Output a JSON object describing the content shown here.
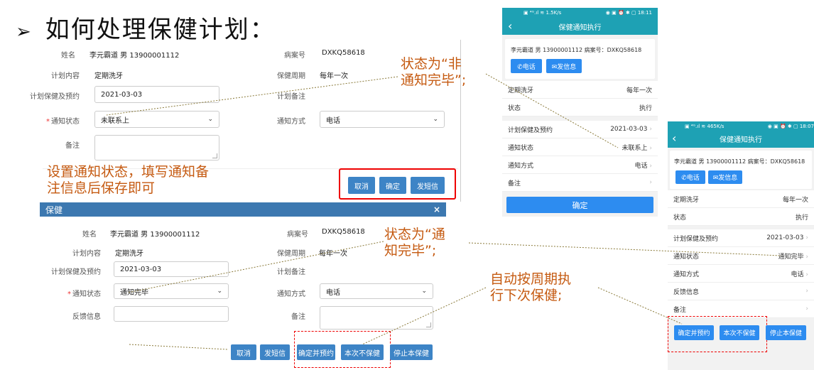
{
  "slide": {
    "arrow": "➢",
    "title": "如何处理保健计划："
  },
  "form_top": {
    "name_label": "姓名",
    "name_value": "李元霸道 男 13900001112",
    "record_label": "病案号",
    "record_value": "DXKQ58618",
    "plan_label": "计划内容",
    "plan_value": "定期洗牙",
    "cycle_label": "保健周期",
    "cycle_value": "每年一次",
    "appoint_label": "计划保健及预约",
    "appoint_value": "2021-03-03",
    "plan_note_label": "计划备注",
    "status_label": "通知状态",
    "status_value": "未联系上",
    "method_label": "通知方式",
    "method_value": "电话",
    "remark_label": "备注",
    "buttons": {
      "cancel": "取消",
      "confirm": "确定",
      "sms": "发短信"
    }
  },
  "annotations": {
    "a1": [
      "状态为“非",
      "通知完毕”;"
    ],
    "a2": [
      "设置通知状态，填写通知备",
      "注信息后保存即可"
    ],
    "a3": [
      "状态为“通",
      "知完毕”;"
    ],
    "a4": [
      "自动按周期执",
      "行下次保健;"
    ]
  },
  "dialog": {
    "title": "保健",
    "close": "×",
    "name_label": "姓名",
    "name_value": "李元霸道 男 13900001112",
    "record_label": "病案号",
    "record_value": "DXKQ58618",
    "plan_label": "计划内容",
    "plan_value": "定期洗牙",
    "cycle_label": "保健周期",
    "cycle_value": "每年一次",
    "appoint_label": "计划保健及预约",
    "appoint_value": "2021-03-03",
    "plan_note_label": "计划备注",
    "status_label": "通知状态",
    "status_value": "通知完毕",
    "method_label": "通知方式",
    "method_value": "电话",
    "feedback_label": "反馈信息",
    "remark_label": "备注",
    "buttons": {
      "cancel": "取消",
      "sms": "发短信",
      "confirm_appoint": "确定并预约",
      "skip": "本次不保健",
      "stop": "停止本保健"
    }
  },
  "phone1": {
    "status_bar_left": "▣ ⁴ᴳ.ıl ≋ 1.5K/s",
    "status_bar_right": "◉ ▣ ⏰ ✱ ▢ 18:11",
    "back": "‹",
    "title": "保健通知执行",
    "patient": "李元霸道  男 13900001112    病案号：DXKQ58618",
    "call_btn": "✆电话",
    "msg_btn": "✉发信息",
    "rows": [
      {
        "label": "定期洗牙",
        "value": "每年一次"
      },
      {
        "label": "状态",
        "value": "执行"
      }
    ],
    "rows2": [
      {
        "label": "计划保健及预约",
        "value": "2021-03-03"
      },
      {
        "label": "通知状态",
        "value": "未联系上"
      },
      {
        "label": "通知方式",
        "value": "电话"
      },
      {
        "label": "备注",
        "value": ""
      }
    ],
    "confirm": "确定"
  },
  "phone2": {
    "status_bar_left": "▣ ⁴ᴳ.ıl ≋ 465K/s",
    "status_bar_right": "◉ ▣ ⏰ ✱ ▢ 18:07",
    "back": "‹",
    "title": "保健通知执行",
    "patient": "李元霸道  男 13900001112    病案号：DXKQ58618",
    "call_btn": "✆电话",
    "msg_btn": "✉发信息",
    "rows": [
      {
        "label": "定期洗牙",
        "value": "每年一次"
      },
      {
        "label": "状态",
        "value": "执行"
      }
    ],
    "rows2": [
      {
        "label": "计划保健及预约",
        "value": "2021-03-03"
      },
      {
        "label": "通知状态",
        "value": "通知完毕"
      },
      {
        "label": "通知方式",
        "value": "电话"
      },
      {
        "label": "反馈信息",
        "value": ""
      },
      {
        "label": "备注",
        "value": ""
      }
    ],
    "buttons": {
      "confirm_appoint": "确定并预约",
      "skip": "本次不保健",
      "stop": "停止本保健"
    }
  },
  "colors": {
    "annotation": "#c55a11",
    "primary_button": "#3d84c6",
    "phone_header": "#1ea1b4",
    "highlight": "#e00000"
  }
}
